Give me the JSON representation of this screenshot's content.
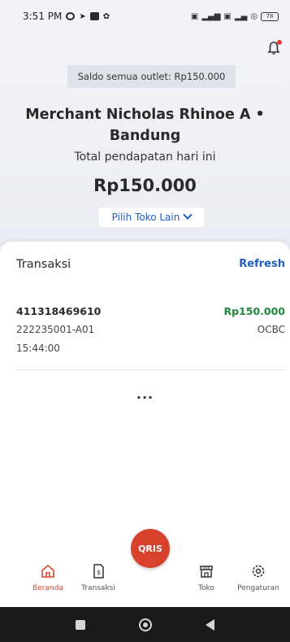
{
  "status_bar": {
    "time": "3:51 PM",
    "battery": "78"
  },
  "header": {
    "saldo": "Saldo semua outlet: Rp150.000",
    "merchant_name": "Merchant Nicholas Rhinoe A • Bandung",
    "income_label": "Total pendapatan hari ini",
    "income_amount": "Rp150.000",
    "pilih_label": "Pilih Toko Lain"
  },
  "transactions": {
    "title": "Transaksi",
    "refresh_label": "Refresh",
    "items": [
      {
        "id": "411318469610",
        "amount": "Rp150.000",
        "ref": "222235001-A01",
        "bank": "OCBC",
        "time": "15:44:00"
      }
    ],
    "more": "..."
  },
  "bottom_nav": {
    "items": [
      {
        "label": "Beranda",
        "icon": "home-icon",
        "active": true
      },
      {
        "label": "Transaksi",
        "icon": "receipt-icon",
        "active": false
      },
      {
        "label": "Toko",
        "icon": "store-icon",
        "active": false
      },
      {
        "label": "Pengaturan",
        "icon": "gear-icon",
        "active": false
      }
    ],
    "fab_label": "QRIS"
  },
  "colors": {
    "accent": "#d8412c",
    "link": "#1f5fc4",
    "positive": "#1e8a3a"
  }
}
